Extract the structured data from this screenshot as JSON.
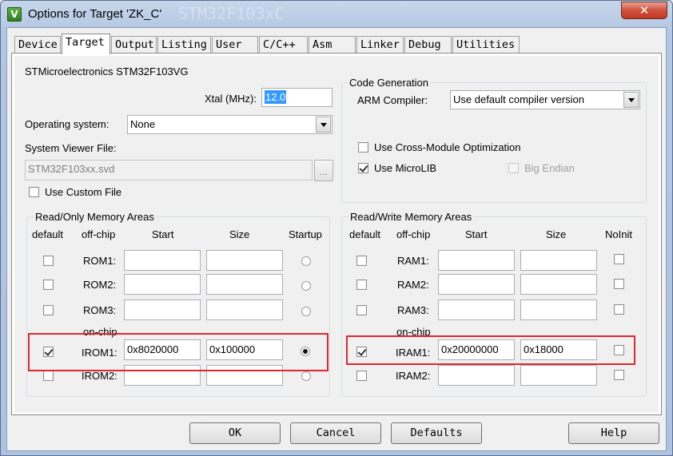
{
  "window": {
    "title": "Options for Target 'ZK_C'",
    "background_title_fragment": "STM32F103xC",
    "close_label": "✕",
    "app_icon_label": "V"
  },
  "tabs": [
    {
      "label": "Device",
      "active": false
    },
    {
      "label": "Target",
      "active": true
    },
    {
      "label": "Output",
      "active": false
    },
    {
      "label": "Listing",
      "active": false
    },
    {
      "label": "User",
      "active": false
    },
    {
      "label": "C/C++",
      "active": false
    },
    {
      "label": "Asm",
      "active": false
    },
    {
      "label": "Linker",
      "active": false
    },
    {
      "label": "Debug",
      "active": false
    },
    {
      "label": "Utilities",
      "active": false
    }
  ],
  "target": {
    "device_name": "STMicroelectronics STM32F103VG",
    "xtal_label": "Xtal (MHz):",
    "xtal_value": "12.0",
    "os_label": "Operating system:",
    "os_value": "None",
    "svd_label": "System Viewer File:",
    "svd_value": "STM32F103xx.svd",
    "browse_label": "...",
    "custom_file_label": "Use Custom File",
    "custom_file_checked": false
  },
  "code_generation": {
    "title": "Code Generation",
    "compiler_label": "ARM Compiler:",
    "compiler_value": "Use default compiler version",
    "cross_module_label": "Use Cross-Module Optimization",
    "cross_module_checked": false,
    "microlib_label": "Use MicroLIB",
    "microlib_checked": true,
    "big_endian_label": "Big Endian",
    "big_endian_checked": false
  },
  "rom_areas": {
    "title": "Read/Only Memory Areas",
    "headers": {
      "default": "default",
      "offchip": "off-chip",
      "start": "Start",
      "size": "Size",
      "last": "Startup"
    },
    "onchip_label": "on-chip",
    "rows": [
      {
        "label": "ROM1:",
        "default": false,
        "start": "",
        "size": "",
        "startup": false
      },
      {
        "label": "ROM2:",
        "default": false,
        "start": "",
        "size": "",
        "startup": false
      },
      {
        "label": "ROM3:",
        "default": false,
        "start": "",
        "size": "",
        "startup": false
      },
      {
        "label": "IROM1:",
        "default": true,
        "start": "0x8020000",
        "size": "0x100000",
        "startup": true
      },
      {
        "label": "IROM2:",
        "default": false,
        "start": "",
        "size": "",
        "startup": false
      }
    ]
  },
  "ram_areas": {
    "title": "Read/Write Memory Areas",
    "headers": {
      "default": "default",
      "offchip": "off-chip",
      "start": "Start",
      "size": "Size",
      "last": "NoInit"
    },
    "onchip_label": "on-chip",
    "rows": [
      {
        "label": "RAM1:",
        "default": false,
        "start": "",
        "size": "",
        "noinit": false
      },
      {
        "label": "RAM2:",
        "default": false,
        "start": "",
        "size": "",
        "noinit": false
      },
      {
        "label": "RAM3:",
        "default": false,
        "start": "",
        "size": "",
        "noinit": false
      },
      {
        "label": "IRAM1:",
        "default": true,
        "start": "0x20000000",
        "size": "0x18000",
        "noinit": false
      },
      {
        "label": "IRAM2:",
        "default": false,
        "start": "",
        "size": "",
        "noinit": false
      }
    ]
  },
  "buttons": {
    "ok": "OK",
    "cancel": "Cancel",
    "defaults": "Defaults",
    "help": "Help"
  },
  "colors": {
    "highlight": "#e0262f",
    "selection": "#3399ff"
  }
}
